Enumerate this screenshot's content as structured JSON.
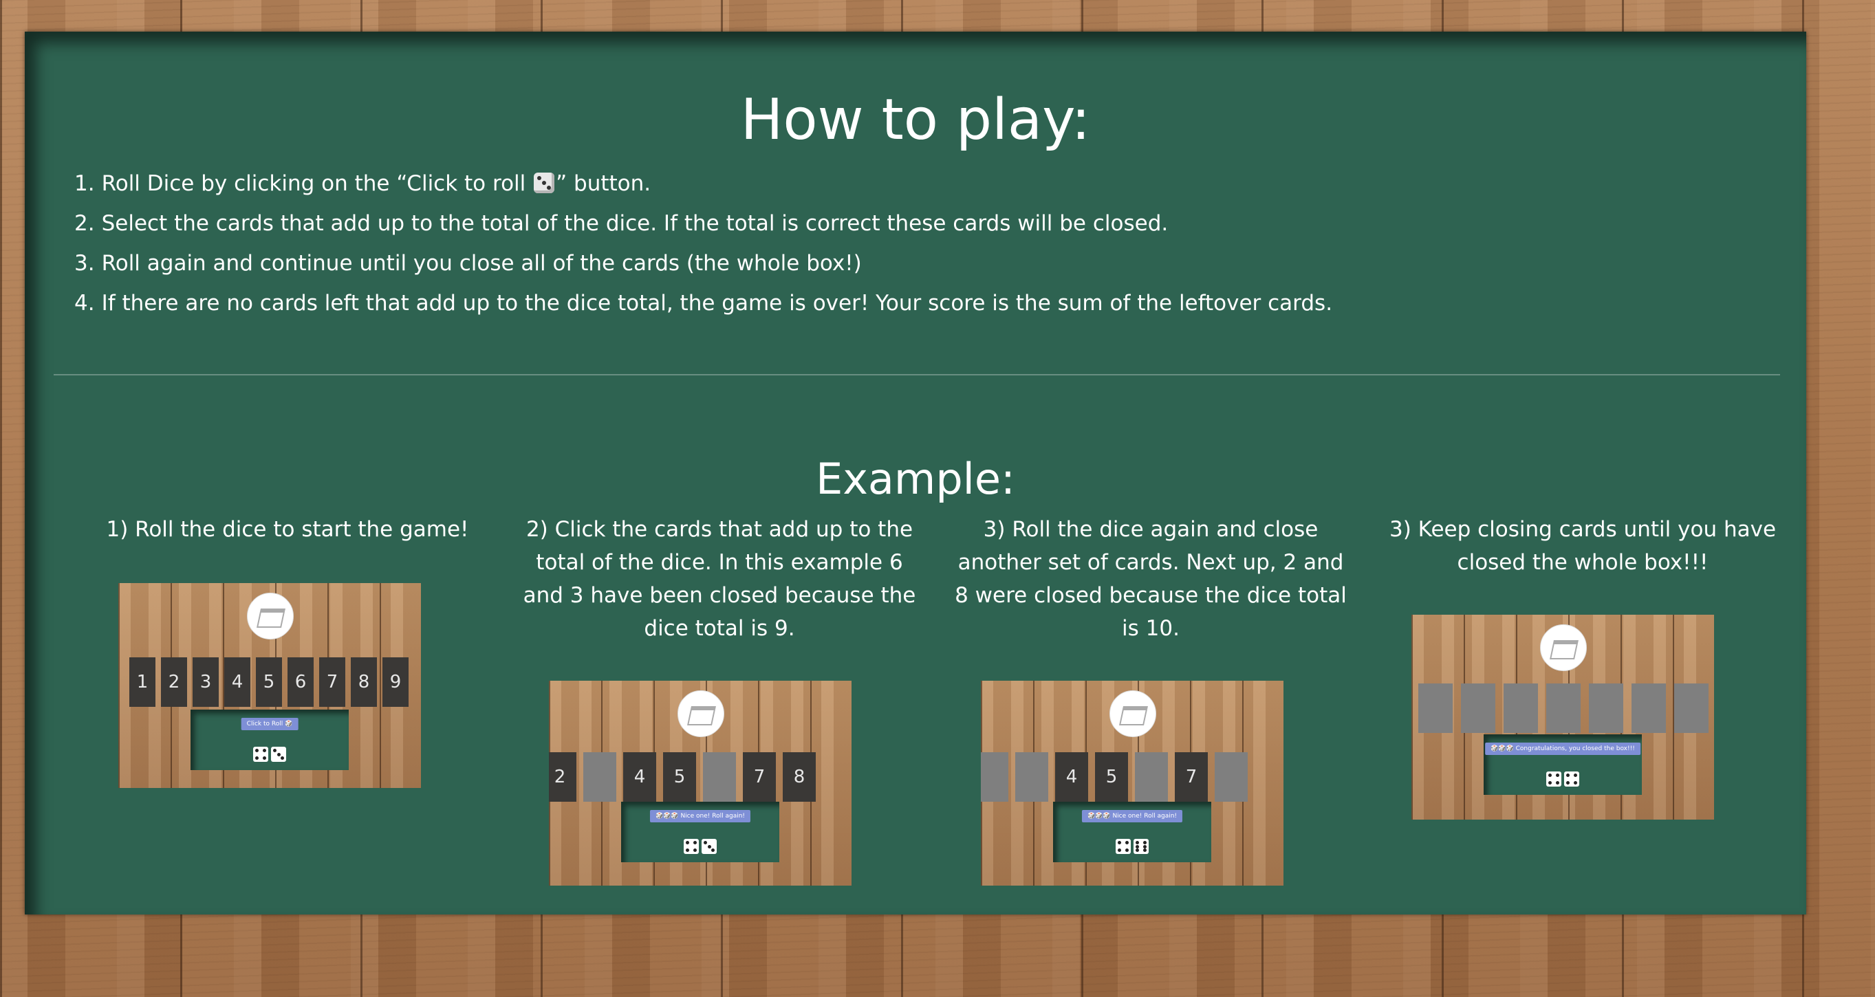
{
  "how_to_play": {
    "title": "How to play:",
    "steps": [
      {
        "num": "1.",
        "before": "Roll Dice by clicking on the “Click to roll ",
        "after": "” button."
      },
      {
        "num": "2.",
        "text": "Select the cards that add up to the total of the dice. If the total is correct these cards will be closed."
      },
      {
        "num": "3.",
        "text": "Roll again and continue until you close all of the cards (the whole box!)"
      },
      {
        "num": "4.",
        "text": "If there are no cards left that add up to the dice total, the game is over! Your score is the sum of the leftover cards."
      }
    ],
    "die_icon": "die-icon"
  },
  "example": {
    "title": "Example:",
    "captions": [
      "1) Roll the dice to start the game!",
      "2) Click the cards that add up to the total of the dice. In this example 6 and 3 have been closed because the dice total is 9.",
      "3) Roll the dice again and close another set of cards. Next up, 2 and 8 were closed because the dice total is 10.",
      "3) Keep closing cards until you have closed the whole box!!!"
    ],
    "screens": [
      {
        "cards": [
          "1",
          "2",
          "3",
          "4",
          "5",
          "6",
          "7",
          "8",
          "9"
        ],
        "button": "Click to Roll 🎲",
        "dice": [
          4,
          3
        ]
      },
      {
        "cards": [
          "2",
          "",
          "4",
          "5",
          "",
          "7",
          "8"
        ],
        "closed": [
          1,
          4
        ],
        "button": "🎲🎲🎲 Nice one! Roll again!",
        "dice": [
          4,
          3
        ]
      },
      {
        "cards": [
          "",
          "",
          "4",
          "5",
          "",
          "7",
          ""
        ],
        "closed": [
          0,
          1,
          4,
          6
        ],
        "button": "🎲🎲🎲 Nice one! Roll again!",
        "dice": [
          4,
          6
        ]
      },
      {
        "cards": [
          "",
          "",
          "",
          "",
          "",
          "",
          ""
        ],
        "closed": [
          0,
          1,
          2,
          3,
          4,
          5,
          6
        ],
        "button": "🎲🎲🎲 Congratulations, you closed the box!!!",
        "dice": [
          4,
          4
        ]
      }
    ]
  }
}
